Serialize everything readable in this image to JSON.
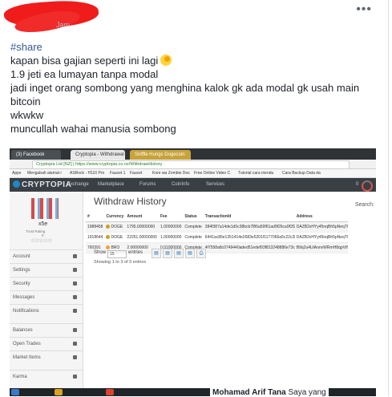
{
  "post": {
    "meta": "Jam",
    "more_icon": "more-horizontal-icon",
    "hashtag": "#share",
    "lines": [
      "kapan bisa gajian seperti ini lagi",
      "1.9 jeti ea lumayan tanpa modal",
      "jadi inget orang sombong yang menghina kalok gk ada modal gk usah main",
      "bitcoin",
      "wkwkw",
      "muncullah wahai manusia sombong"
    ],
    "emoji_icon": "moon-emoji-icon"
  },
  "screenshot": {
    "browser_tabs": [
      "(3) Facebook",
      "Cryptopia - Withdrawal",
      "Sniffle Hungs Dogecoin"
    ],
    "url_secure": "Cryptopia Ltd [NZ]",
    "url": "https://www.cryptopia.co.nz/WithdrawHistory",
    "bookmarks": [
      "Apps",
      "Mengubah alamat r",
      "ASRock - H110 Pro",
      "Faucet 1",
      "Faucet",
      "Kore wa Zombie Des",
      "Free Online Video C",
      "Tutorial cara mendu",
      "Cara Backup Data da"
    ],
    "nav": {
      "logo": "CRYPTOPIA",
      "items": [
        "Exchange",
        "Marketplace",
        "Forums",
        "CoinInfo",
        "Services"
      ],
      "right_badge": "0"
    },
    "sidebar": {
      "username": "x5e",
      "trust_label": "Trust Rating",
      "trust_value": "0",
      "stars": "☆☆☆☆☆",
      "menu": [
        "Account",
        "Settings",
        "Security",
        "Messages",
        "Notifications",
        "Balances",
        "Open Trades",
        "Market Items",
        "Karma"
      ]
    },
    "content": {
      "title": "Withdraw History",
      "search_label": "Search:",
      "columns": [
        "#",
        "Currency",
        "Amount",
        "Fee",
        "Status",
        "TransactionId",
        "Address"
      ],
      "rows": [
        [
          "1988458",
          "DOGE",
          "1795.00000000",
          "1.00000000",
          "Complete",
          "384f387a14de1d5c38bcb7f86a59f61ad9f26ca9f2f2b...",
          "DAZB2xHYy45nqBh5pNeqTUR1HEF2..."
        ],
        [
          "1918644",
          "DOGE",
          "22251.00000000",
          "1.00000000",
          "Complete",
          "6441ac86e1351414e2683e5201f1177066a5c22c2b8c...",
          "DAZB2xHYy45nqBh5pNeqTUR1HEF2..."
        ],
        [
          "760391",
          "BRO",
          "2.00000000",
          "0.01000000",
          "Complete",
          "4f7558a8c0749440aded51edef93f813248886e73c...",
          "B9q2u4UiAonvWRmH8qpVtfSpFm..."
        ]
      ],
      "show_label": "Show",
      "show_value": "15",
      "entries_label": "entries",
      "info": "Showing 1 to 3 of 3 entries"
    }
  },
  "caption": {
    "name": "Mohamad Arif Tana",
    "suffix": "Saya yang"
  }
}
